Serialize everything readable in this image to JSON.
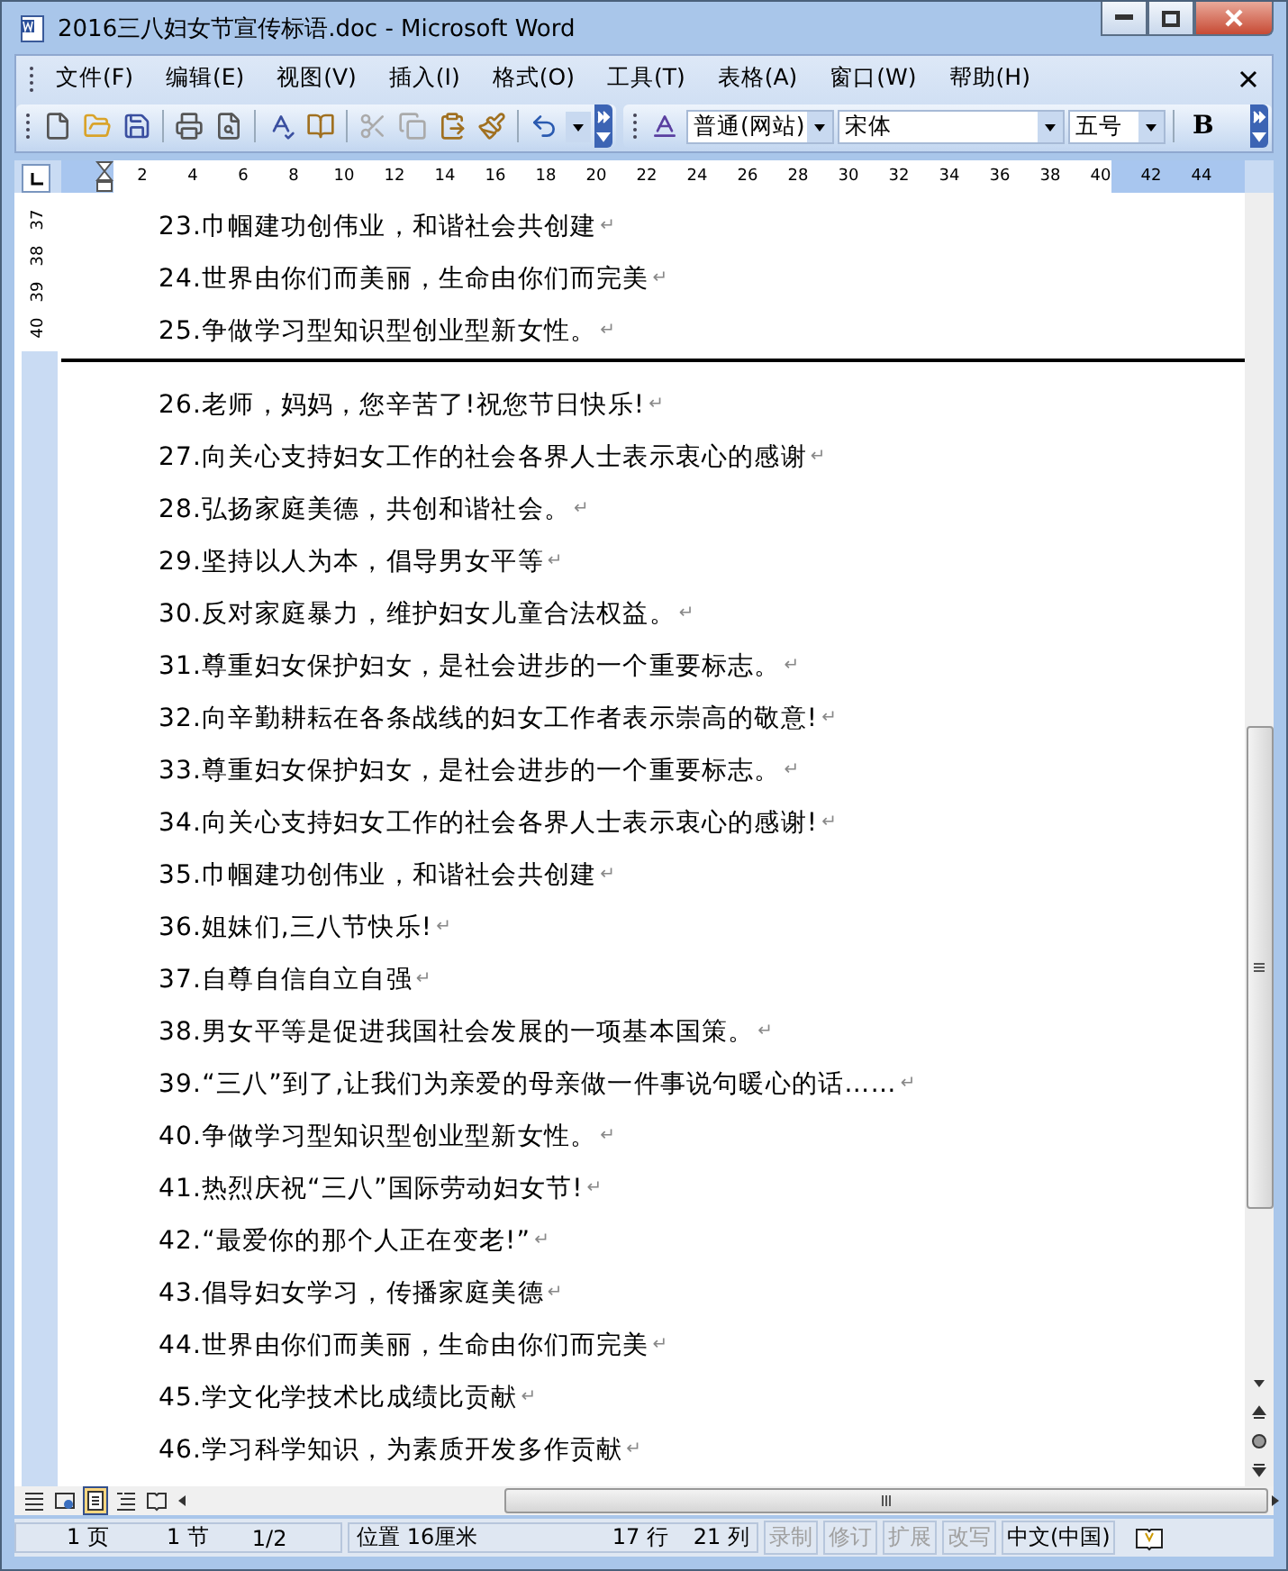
{
  "window": {
    "title": "2016三八妇女节宣传标语.doc - Microsoft Word"
  },
  "menu": [
    "文件(F)",
    "编辑(E)",
    "视图(V)",
    "插入(I)",
    "格式(O)",
    "工具(T)",
    "表格(A)",
    "窗口(W)",
    "帮助(H)"
  ],
  "toolbar": {
    "style": "普通(网站)",
    "font": "宋体",
    "size": "五号",
    "bold": "B"
  },
  "ruler": [
    "2",
    "4",
    "6",
    "8",
    "10",
    "12",
    "14",
    "16",
    "18",
    "20",
    "22",
    "24",
    "26",
    "28",
    "30",
    "32",
    "34",
    "36",
    "38",
    "40",
    "42",
    "44"
  ],
  "vertical_ruler": [
    "37",
    "38",
    "39",
    "40"
  ],
  "document": {
    "before_break": [
      {
        "text": "23.巾帼建功创伟业，和谐社会共创建",
        "mark": "↵"
      },
      {
        "text": "24.世界由你们而美丽，生命由你们而完美",
        "mark": "↵"
      },
      {
        "text": "25.争做学习型知识型创业型新女性。",
        "mark": "↵"
      }
    ],
    "after_break": [
      {
        "text": "26.老师，妈妈，您辛苦了!祝您节日快乐!",
        "mark": "↵"
      },
      {
        "text": "27.向关心支持妇女工作的社会各界人士表示衷心的感谢",
        "mark": "↵"
      },
      {
        "text": "28.弘扬家庭美德，共创和谐社会。",
        "mark": "↵"
      },
      {
        "text": "29.坚持以人为本，倡导男女平等",
        "mark": "↵"
      },
      {
        "text": "30.反对家庭暴力，维护妇女儿童合法权益。",
        "mark": "↵"
      },
      {
        "text": "31.尊重妇女保护妇女，是社会进步的一个重要标志。",
        "mark": "↵"
      },
      {
        "text": "32.向辛勤耕耘在各条战线的妇女工作者表示崇高的敬意!",
        "mark": "↵"
      },
      {
        "text": "33.尊重妇女保护妇女，是社会进步的一个重要标志。",
        "mark": "↵"
      },
      {
        "text": "34.向关心支持妇女工作的社会各界人士表示衷心的感谢!",
        "mark": "↵"
      },
      {
        "text": "35.巾帼建功创伟业，和谐社会共创建",
        "mark": "↵"
      },
      {
        "text": "36.姐妹们,三八节快乐!",
        "mark": "↵"
      },
      {
        "text": "37.自尊自信自立自强",
        "mark": "↵"
      },
      {
        "text": "38.男女平等是促进我国社会发展的一项基本国策。",
        "mark": "↵"
      },
      {
        "text": "39.“三八”到了,让我们为亲爱的母亲做一件事说句暖心的话……",
        "mark": "↵"
      },
      {
        "text": "40.争做学习型知识型创业型新女性。",
        "mark": "↵"
      },
      {
        "text": "41.热烈庆祝“三八”国际劳动妇女节!",
        "mark": "↵"
      },
      {
        "text": "42.“最爱你的那个人正在变老!”",
        "mark": "↵"
      },
      {
        "text": "43.倡导妇女学习，传播家庭美德",
        "mark": "↵"
      },
      {
        "text": "44.世界由你们而美丽，生命由你们而完美",
        "mark": "↵"
      },
      {
        "text": "45.学文化学技术比成绩比贡献",
        "mark": "↵"
      },
      {
        "text": "46.学习科学知识，为素质开发多作贡献",
        "mark": "↵"
      }
    ]
  },
  "view_buttons": [
    {
      "kind": "normal",
      "selected": false
    },
    {
      "kind": "web",
      "selected": false
    },
    {
      "kind": "print",
      "selected": true
    },
    {
      "kind": "outline",
      "selected": false
    },
    {
      "kind": "reading",
      "selected": false
    }
  ],
  "status_bar": {
    "page": "1 页",
    "section": "1 节",
    "pages": "1/2",
    "position": "位置 16厘米",
    "line": "17 行",
    "column": "21 列",
    "modes": [
      {
        "label": "录制",
        "disabled": true
      },
      {
        "label": "修订",
        "disabled": true
      },
      {
        "label": "扩展",
        "disabled": true
      },
      {
        "label": "改写",
        "disabled": true
      }
    ],
    "language": "中文(中国)"
  }
}
